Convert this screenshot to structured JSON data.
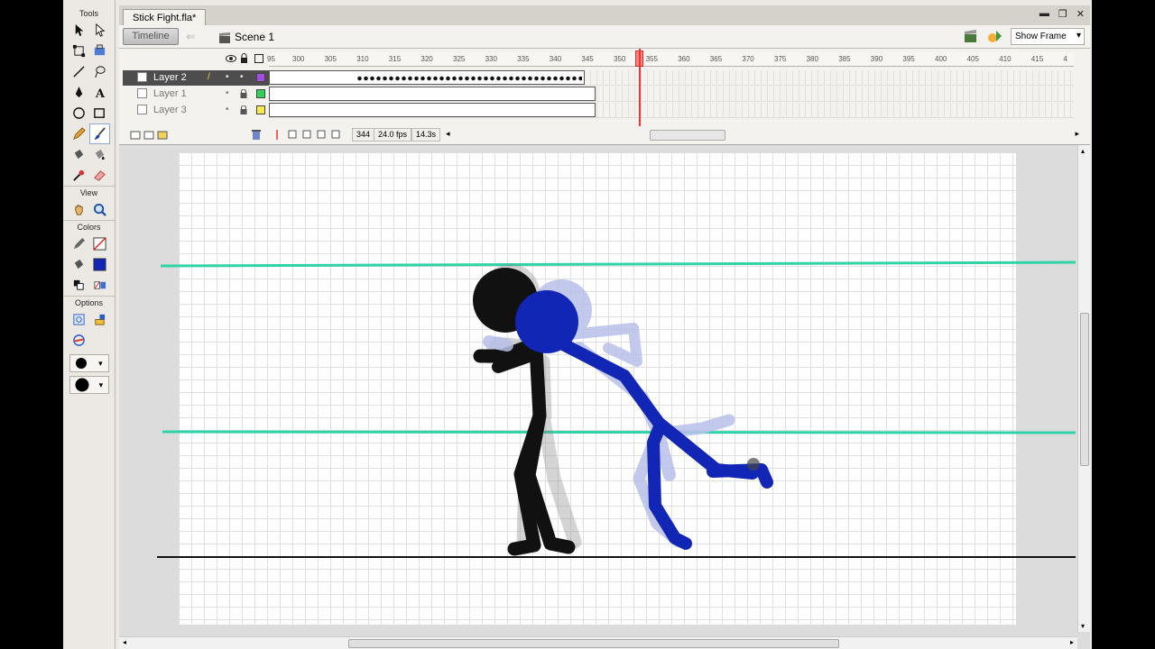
{
  "document": {
    "tab_title": "Stick Fight.fla*"
  },
  "tools_panel": {
    "tools_label": "Tools",
    "view_label": "View",
    "colors_label": "Colors",
    "options_label": "Options"
  },
  "edit_bar": {
    "timeline_button": "Timeline",
    "scene_label": "Scene 1",
    "zoom_select": "Show Frame"
  },
  "timeline": {
    "ruler_ticks": [
      "95",
      "300",
      "305",
      "310",
      "315",
      "320",
      "325",
      "330",
      "335",
      "340",
      "345",
      "350",
      "355",
      "360",
      "365",
      "370",
      "375",
      "380",
      "385",
      "390",
      "395",
      "400",
      "405",
      "410",
      "415",
      "4"
    ],
    "layers": [
      {
        "name": "Layer 2",
        "active": true,
        "color": "#a64ce0"
      },
      {
        "name": "Layer 1",
        "active": false,
        "color": "#2ed35a"
      },
      {
        "name": "Layer 3",
        "active": false,
        "color": "#f7ea4a"
      }
    ],
    "status": {
      "current_frame": "344",
      "frame_rate": "24.0 fps",
      "elapsed_time": "14.3s"
    }
  },
  "colors": {
    "guide_line": "#2fd3a6",
    "black_fighter": "#111111",
    "blue_fighter": "#1126b4",
    "blue_onion": "#b8c0ea",
    "black_onion": "#c8c8c8"
  }
}
